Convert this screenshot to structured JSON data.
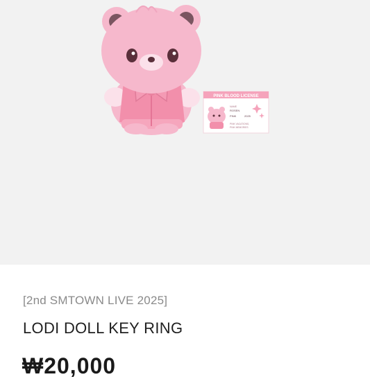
{
  "product": {
    "image_alt": "LODI DOLL KEY RING",
    "license_card": {
      "title": "PINK BLOOD LICENSE",
      "field_name": "NAME",
      "value_name": "ROSEN",
      "field_type": "PINK",
      "value_year": "2025",
      "footer_line1": "PINK VACATIONS,",
      "footer_line2": "PINK MEMORIES"
    },
    "collection": "[2nd SMTOWN LIVE 2025]",
    "name": "LODI DOLL KEY RING",
    "price": "₩20,000"
  },
  "colors": {
    "bear_pink": "#f6b8cc",
    "jacket_pink": "#f28fab",
    "card_header": "#f5a3bb",
    "background": "#f2f2f2"
  }
}
